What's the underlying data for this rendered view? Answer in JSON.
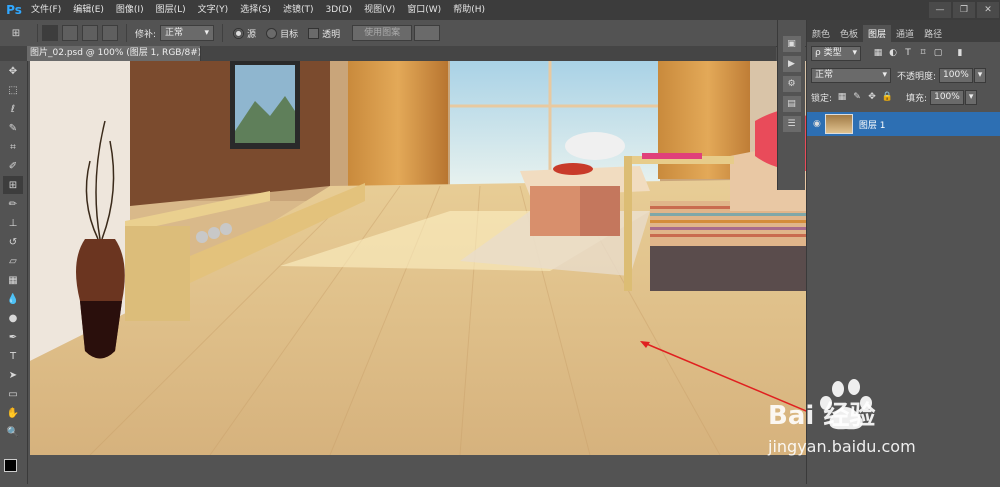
{
  "app": {
    "logo": "Ps"
  },
  "menu": [
    "文件(F)",
    "编辑(E)",
    "图像(I)",
    "图层(L)",
    "文字(Y)",
    "选择(S)",
    "滤镜(T)",
    "3D(D)",
    "视图(V)",
    "窗口(W)",
    "帮助(H)"
  ],
  "window_controls": [
    "—",
    "❐",
    "✕"
  ],
  "options": {
    "patch_label": "修补:",
    "patch_mode": "正常",
    "source_label": "源",
    "dest_label": "目标",
    "transparent_label": "透明",
    "use_pattern": "使用图案"
  },
  "doc_tab": {
    "title": "图片_02.psd @ 100% (图层 1, RGB/8#) * ×"
  },
  "panel": {
    "tabs": [
      "颜色",
      "色板",
      "图层",
      "通道",
      "路径"
    ],
    "active_tab": "图层",
    "filter_kind": "ρ 类型",
    "blend_mode": "正常",
    "opacity_label": "不透明度:",
    "opacity_value": "100%",
    "lock_label": "锁定:",
    "fill_label": "填充:",
    "fill_value": "100%",
    "layer_name": "图层 1"
  },
  "watermark": {
    "brand": "Bai 经验",
    "url": "jingyan.baidu.com"
  },
  "colors": {
    "accent": "#31a8ff",
    "selected_layer": "#2d6fb3",
    "arrow": "#e02020"
  }
}
